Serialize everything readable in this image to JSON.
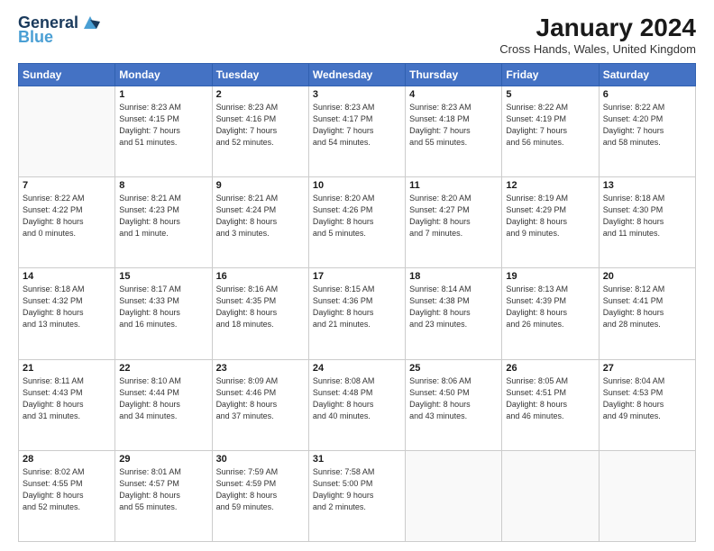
{
  "logo": {
    "line1": "General",
    "line2": "Blue"
  },
  "title": "January 2024",
  "subtitle": "Cross Hands, Wales, United Kingdom",
  "days_header": [
    "Sunday",
    "Monday",
    "Tuesday",
    "Wednesday",
    "Thursday",
    "Friday",
    "Saturday"
  ],
  "weeks": [
    [
      {
        "day": "",
        "info": ""
      },
      {
        "day": "1",
        "info": "Sunrise: 8:23 AM\nSunset: 4:15 PM\nDaylight: 7 hours\nand 51 minutes."
      },
      {
        "day": "2",
        "info": "Sunrise: 8:23 AM\nSunset: 4:16 PM\nDaylight: 7 hours\nand 52 minutes."
      },
      {
        "day": "3",
        "info": "Sunrise: 8:23 AM\nSunset: 4:17 PM\nDaylight: 7 hours\nand 54 minutes."
      },
      {
        "day": "4",
        "info": "Sunrise: 8:23 AM\nSunset: 4:18 PM\nDaylight: 7 hours\nand 55 minutes."
      },
      {
        "day": "5",
        "info": "Sunrise: 8:22 AM\nSunset: 4:19 PM\nDaylight: 7 hours\nand 56 minutes."
      },
      {
        "day": "6",
        "info": "Sunrise: 8:22 AM\nSunset: 4:20 PM\nDaylight: 7 hours\nand 58 minutes."
      }
    ],
    [
      {
        "day": "7",
        "info": "Sunrise: 8:22 AM\nSunset: 4:22 PM\nDaylight: 8 hours\nand 0 minutes."
      },
      {
        "day": "8",
        "info": "Sunrise: 8:21 AM\nSunset: 4:23 PM\nDaylight: 8 hours\nand 1 minute."
      },
      {
        "day": "9",
        "info": "Sunrise: 8:21 AM\nSunset: 4:24 PM\nDaylight: 8 hours\nand 3 minutes."
      },
      {
        "day": "10",
        "info": "Sunrise: 8:20 AM\nSunset: 4:26 PM\nDaylight: 8 hours\nand 5 minutes."
      },
      {
        "day": "11",
        "info": "Sunrise: 8:20 AM\nSunset: 4:27 PM\nDaylight: 8 hours\nand 7 minutes."
      },
      {
        "day": "12",
        "info": "Sunrise: 8:19 AM\nSunset: 4:29 PM\nDaylight: 8 hours\nand 9 minutes."
      },
      {
        "day": "13",
        "info": "Sunrise: 8:18 AM\nSunset: 4:30 PM\nDaylight: 8 hours\nand 11 minutes."
      }
    ],
    [
      {
        "day": "14",
        "info": "Sunrise: 8:18 AM\nSunset: 4:32 PM\nDaylight: 8 hours\nand 13 minutes."
      },
      {
        "day": "15",
        "info": "Sunrise: 8:17 AM\nSunset: 4:33 PM\nDaylight: 8 hours\nand 16 minutes."
      },
      {
        "day": "16",
        "info": "Sunrise: 8:16 AM\nSunset: 4:35 PM\nDaylight: 8 hours\nand 18 minutes."
      },
      {
        "day": "17",
        "info": "Sunrise: 8:15 AM\nSunset: 4:36 PM\nDaylight: 8 hours\nand 21 minutes."
      },
      {
        "day": "18",
        "info": "Sunrise: 8:14 AM\nSunset: 4:38 PM\nDaylight: 8 hours\nand 23 minutes."
      },
      {
        "day": "19",
        "info": "Sunrise: 8:13 AM\nSunset: 4:39 PM\nDaylight: 8 hours\nand 26 minutes."
      },
      {
        "day": "20",
        "info": "Sunrise: 8:12 AM\nSunset: 4:41 PM\nDaylight: 8 hours\nand 28 minutes."
      }
    ],
    [
      {
        "day": "21",
        "info": "Sunrise: 8:11 AM\nSunset: 4:43 PM\nDaylight: 8 hours\nand 31 minutes."
      },
      {
        "day": "22",
        "info": "Sunrise: 8:10 AM\nSunset: 4:44 PM\nDaylight: 8 hours\nand 34 minutes."
      },
      {
        "day": "23",
        "info": "Sunrise: 8:09 AM\nSunset: 4:46 PM\nDaylight: 8 hours\nand 37 minutes."
      },
      {
        "day": "24",
        "info": "Sunrise: 8:08 AM\nSunset: 4:48 PM\nDaylight: 8 hours\nand 40 minutes."
      },
      {
        "day": "25",
        "info": "Sunrise: 8:06 AM\nSunset: 4:50 PM\nDaylight: 8 hours\nand 43 minutes."
      },
      {
        "day": "26",
        "info": "Sunrise: 8:05 AM\nSunset: 4:51 PM\nDaylight: 8 hours\nand 46 minutes."
      },
      {
        "day": "27",
        "info": "Sunrise: 8:04 AM\nSunset: 4:53 PM\nDaylight: 8 hours\nand 49 minutes."
      }
    ],
    [
      {
        "day": "28",
        "info": "Sunrise: 8:02 AM\nSunset: 4:55 PM\nDaylight: 8 hours\nand 52 minutes."
      },
      {
        "day": "29",
        "info": "Sunrise: 8:01 AM\nSunset: 4:57 PM\nDaylight: 8 hours\nand 55 minutes."
      },
      {
        "day": "30",
        "info": "Sunrise: 7:59 AM\nSunset: 4:59 PM\nDaylight: 8 hours\nand 59 minutes."
      },
      {
        "day": "31",
        "info": "Sunrise: 7:58 AM\nSunset: 5:00 PM\nDaylight: 9 hours\nand 2 minutes."
      },
      {
        "day": "",
        "info": ""
      },
      {
        "day": "",
        "info": ""
      },
      {
        "day": "",
        "info": ""
      }
    ]
  ]
}
